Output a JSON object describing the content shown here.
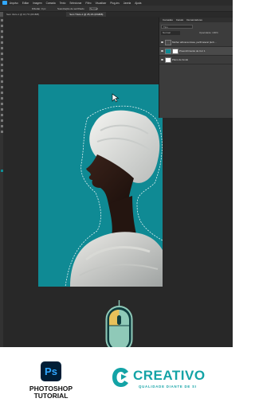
{
  "app": {
    "logo_label": "Ps",
    "menu": [
      "Arquivo",
      "Editar",
      "Imagem",
      "Camada",
      "Texto",
      "Selecionar",
      "Filtro",
      "Visualizar",
      "Plug-ins",
      "Janela",
      "Ajuda"
    ],
    "options_bar": {
      "feather_label": "Difusão: 0 px",
      "antialias_label": "Suavização de serrilhado",
      "style_label": "Normal"
    }
  },
  "tabs": [
    {
      "label": "Sem título-1 @ 16,7% (RGB/8)"
    },
    {
      "label": "Sem Título-1 @ 25,1% (RGB/8)"
    }
  ],
  "layers_panel": {
    "tabs": [
      "Camadas",
      "Canais",
      "Demarcadores"
    ],
    "search_placeholder": "Tipo",
    "blend_mode": "Normal",
    "opacity_label": "Opacidade: 100%",
    "layers": [
      {
        "name": "Mulher africana idosa, perfil lateral (turb…",
        "selected": false
      },
      {
        "name": "Preenchimento de Cor 1",
        "selected": true
      },
      {
        "name": "Plano de fundo",
        "selected": false
      }
    ]
  },
  "colors": {
    "canvas_bg": "#0f8a94",
    "accent": "#13a3a6",
    "mouse_body": "#8fc9b8",
    "mouse_button": "#e8c15a"
  },
  "footer": {
    "ps_badge": "Ps",
    "tutorial_line1": "PHOTOSHOP",
    "tutorial_line2": "TUTORIAL",
    "brand_name": "CREATIVO",
    "brand_tagline": "QUALIDADE DIANTE DE SI"
  }
}
